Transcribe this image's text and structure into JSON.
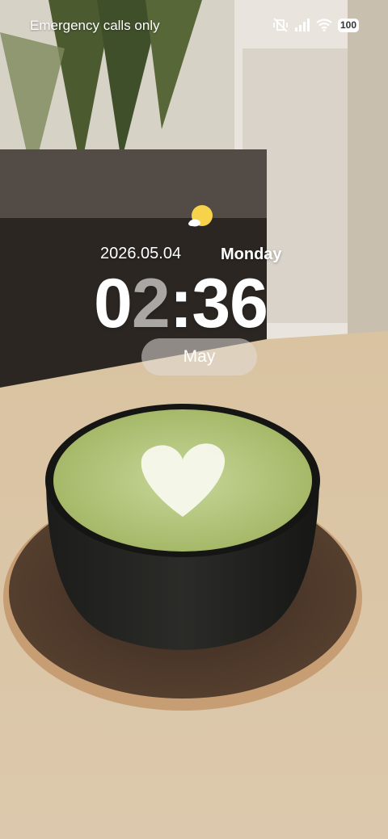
{
  "status_bar": {
    "carrier_text": "Emergency calls only",
    "battery_level": "100",
    "icons": [
      "mute-vibrate-icon",
      "signal-icon",
      "wifi-icon",
      "battery-icon"
    ]
  },
  "lockscreen": {
    "weather_icon": "sun-cloud-icon",
    "date": "2026.05.04",
    "weekday": "Monday",
    "time": {
      "hour_tens": "0",
      "hour_ones": "2",
      "separator": ":",
      "minutes": "36"
    },
    "month_label": "May"
  },
  "wallpaper": {
    "subject": "wallpaper-image"
  }
}
